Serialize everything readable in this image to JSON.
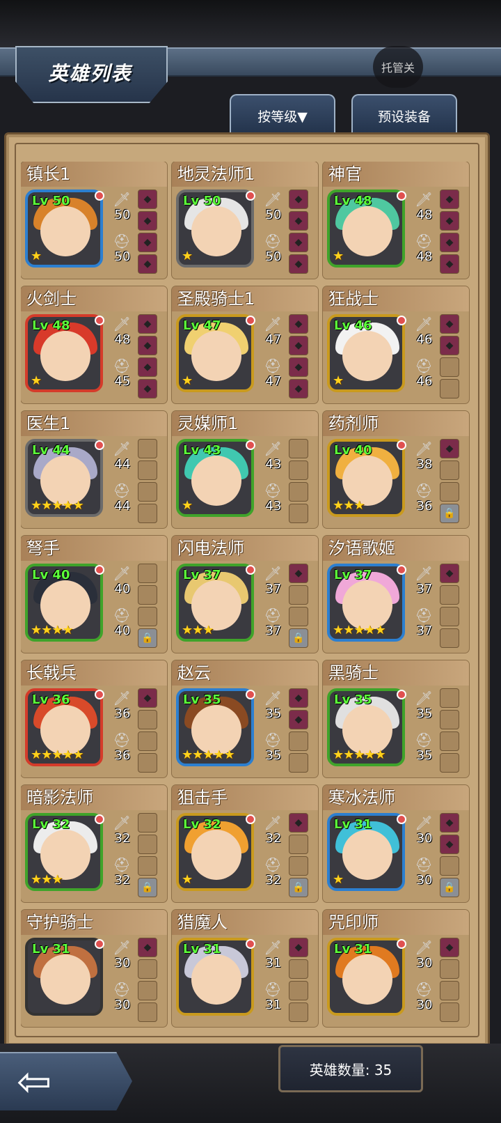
{
  "header": {
    "title": "英雄列表",
    "auto_label": "托管关"
  },
  "tabs": {
    "sort_label": "按等级▼",
    "preset_label": "预设装备"
  },
  "footer": {
    "hero_count": "英雄数量: 35"
  },
  "heroes": [
    {
      "name": "镇长1",
      "lv": "Lv 50",
      "atk": "50",
      "def": "50",
      "stars": "★",
      "border": "#2c7fd0",
      "hair": "#d8822a",
      "slots": [
        "eq",
        "eq",
        "eq",
        "eq"
      ]
    },
    {
      "name": "地灵法师1",
      "lv": "Lv 50",
      "atk": "50",
      "def": "50",
      "stars": "★",
      "border": "#6b6b6b",
      "hair": "#e5e5e5",
      "slots": [
        "eq",
        "eq",
        "eq",
        "eq"
      ]
    },
    {
      "name": "神官",
      "lv": "Lv 48",
      "atk": "48",
      "def": "48",
      "stars": "★",
      "border": "#3fa32a",
      "hair": "#4fc8a0",
      "slots": [
        "eq",
        "eq",
        "eq",
        "eq"
      ]
    },
    {
      "name": "火剑士",
      "lv": "Lv 48",
      "atk": "48",
      "def": "45",
      "stars": "★",
      "border": "#d43b2a",
      "hair": "#d83a2a",
      "slots": [
        "eq",
        "eq",
        "eq",
        "eq"
      ]
    },
    {
      "name": "圣殿骑士1",
      "lv": "Lv 47",
      "atk": "47",
      "def": "47",
      "stars": "★",
      "border": "#c99a1e",
      "hair": "#f0d070",
      "slots": [
        "eq",
        "eq",
        "eq",
        "eq"
      ]
    },
    {
      "name": "狂战士",
      "lv": "Lv 46",
      "atk": "46",
      "def": "46",
      "stars": "★",
      "border": "#c99a1e",
      "hair": "#f2f2f2",
      "slots": [
        "eq",
        "eq",
        "empty",
        "empty"
      ]
    },
    {
      "name": "医生1",
      "lv": "Lv 44",
      "atk": "44",
      "def": "44",
      "stars": "★★★★★",
      "border": "#6b6b6b",
      "hair": "#a9a9c8",
      "slots": [
        "empty",
        "empty",
        "empty",
        "empty"
      ]
    },
    {
      "name": "灵媒师1",
      "lv": "Lv 43",
      "atk": "43",
      "def": "43",
      "stars": "★",
      "border": "#3fa32a",
      "hair": "#40c8b0",
      "slots": [
        "empty",
        "empty",
        "empty",
        "empty"
      ]
    },
    {
      "name": "药剂师",
      "lv": "Lv 40",
      "atk": "38",
      "def": "36",
      "stars": "★★★",
      "border": "#c99a1e",
      "hair": "#f0b040",
      "slots": [
        "eq",
        "empty",
        "empty",
        "lock"
      ]
    },
    {
      "name": "弩手",
      "lv": "Lv 40",
      "atk": "40",
      "def": "40",
      "stars": "★★★★",
      "border": "#3fa32a",
      "hair": "#2a2f3a",
      "slots": [
        "empty",
        "empty",
        "empty",
        "lock"
      ]
    },
    {
      "name": "闪电法师",
      "lv": "Lv 37",
      "atk": "37",
      "def": "37",
      "stars": "★★★",
      "border": "#3fa32a",
      "hair": "#e8c870",
      "slots": [
        "eq",
        "empty",
        "empty",
        "lock"
      ]
    },
    {
      "name": "汐语歌姬",
      "lv": "Lv 37",
      "atk": "37",
      "def": "37",
      "stars": "★★★★★",
      "border": "#2c7fd0",
      "hair": "#f0a8d8",
      "slots": [
        "eq",
        "empty",
        "empty",
        "empty"
      ]
    },
    {
      "name": "长戟兵",
      "lv": "Lv 36",
      "atk": "36",
      "def": "36",
      "stars": "★★★★★",
      "border": "#d43b2a",
      "hair": "#d84a2a",
      "slots": [
        "eq",
        "empty",
        "empty",
        "empty"
      ]
    },
    {
      "name": "赵云",
      "lv": "Lv 35",
      "atk": "35",
      "def": "35",
      "stars": "★★★★★",
      "border": "#2c7fd0",
      "hair": "#8a4a22",
      "slots": [
        "eq",
        "eq",
        "empty",
        "empty"
      ]
    },
    {
      "name": "黑骑士",
      "lv": "Lv 35",
      "atk": "35",
      "def": "35",
      "stars": "★★★★★",
      "border": "#3fa32a",
      "hair": "#e0e0e0",
      "slots": [
        "empty",
        "empty",
        "empty",
        "empty"
      ]
    },
    {
      "name": "暗影法师",
      "lv": "Lv 32",
      "atk": "32",
      "def": "32",
      "stars": "★★★",
      "border": "#3fa32a",
      "hair": "#ececec",
      "slots": [
        "empty",
        "empty",
        "empty",
        "lock"
      ]
    },
    {
      "name": "狙击手",
      "lv": "Lv 32",
      "atk": "32",
      "def": "32",
      "stars": "★",
      "border": "#c99a1e",
      "hair": "#f0a030",
      "slots": [
        "eq",
        "empty",
        "empty",
        "lock"
      ]
    },
    {
      "name": "寒冰法师",
      "lv": "Lv 31",
      "atk": "30",
      "def": "30",
      "stars": "★",
      "border": "#2c7fd0",
      "hair": "#40c0d8",
      "slots": [
        "eq",
        "eq",
        "empty",
        "lock"
      ]
    },
    {
      "name": "守护骑士",
      "lv": "Lv 31",
      "atk": "30",
      "def": "30",
      "stars": "",
      "border": "#333333",
      "hair": "#c07040",
      "slots": [
        "eq",
        "empty",
        "empty",
        "empty"
      ]
    },
    {
      "name": "猎魔人",
      "lv": "Lv 31",
      "atk": "31",
      "def": "31",
      "stars": "",
      "border": "#c99a1e",
      "hair": "#c8c8d8",
      "slots": [
        "eq",
        "empty",
        "empty",
        "empty"
      ]
    },
    {
      "name": "咒印师",
      "lv": "Lv 31",
      "atk": "30",
      "def": "30",
      "stars": "",
      "border": "#c99a1e",
      "hair": "#e07a20",
      "slots": [
        "eq",
        "empty",
        "empty",
        "empty"
      ]
    }
  ]
}
